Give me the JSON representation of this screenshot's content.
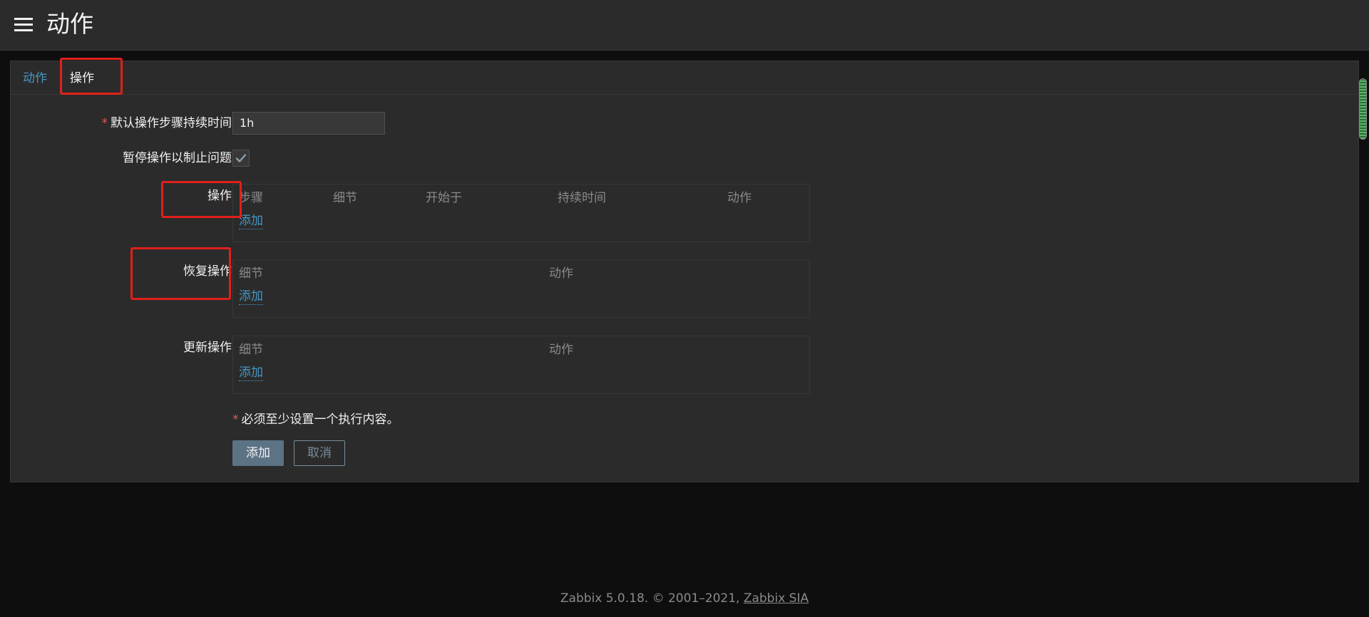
{
  "header": {
    "title": "动作",
    "menu_icon": "hamburger-menu-icon"
  },
  "tabs": [
    {
      "label": "动作"
    },
    {
      "label": "操作"
    }
  ],
  "form": {
    "default_step_duration": {
      "label": "默认操作步骤持续时间",
      "value": "1h",
      "required": true
    },
    "pause_on_problem": {
      "label": "暂停操作以制止问题",
      "checked": true
    },
    "operations": {
      "label": "操作",
      "columns": [
        "步骤",
        "细节",
        "开始于",
        "持续时间",
        "动作"
      ],
      "add_label": "添加"
    },
    "recovery_operations": {
      "label": "恢复操作",
      "columns": [
        "细节",
        "动作"
      ],
      "add_label": "添加"
    },
    "update_operations": {
      "label": "更新操作",
      "columns": [
        "细节",
        "动作"
      ],
      "add_label": "添加"
    },
    "note": "必须至少设置一个执行内容。",
    "add_button": "添加",
    "cancel_button": "取消"
  },
  "footer": {
    "text": "Zabbix 5.0.18. © 2001–2021, ",
    "link": "Zabbix SIA"
  },
  "colors": {
    "accent_link": "#4796c4",
    "primary_button": "#5c7285",
    "highlight": "#e0201b",
    "required": "#e45959"
  }
}
